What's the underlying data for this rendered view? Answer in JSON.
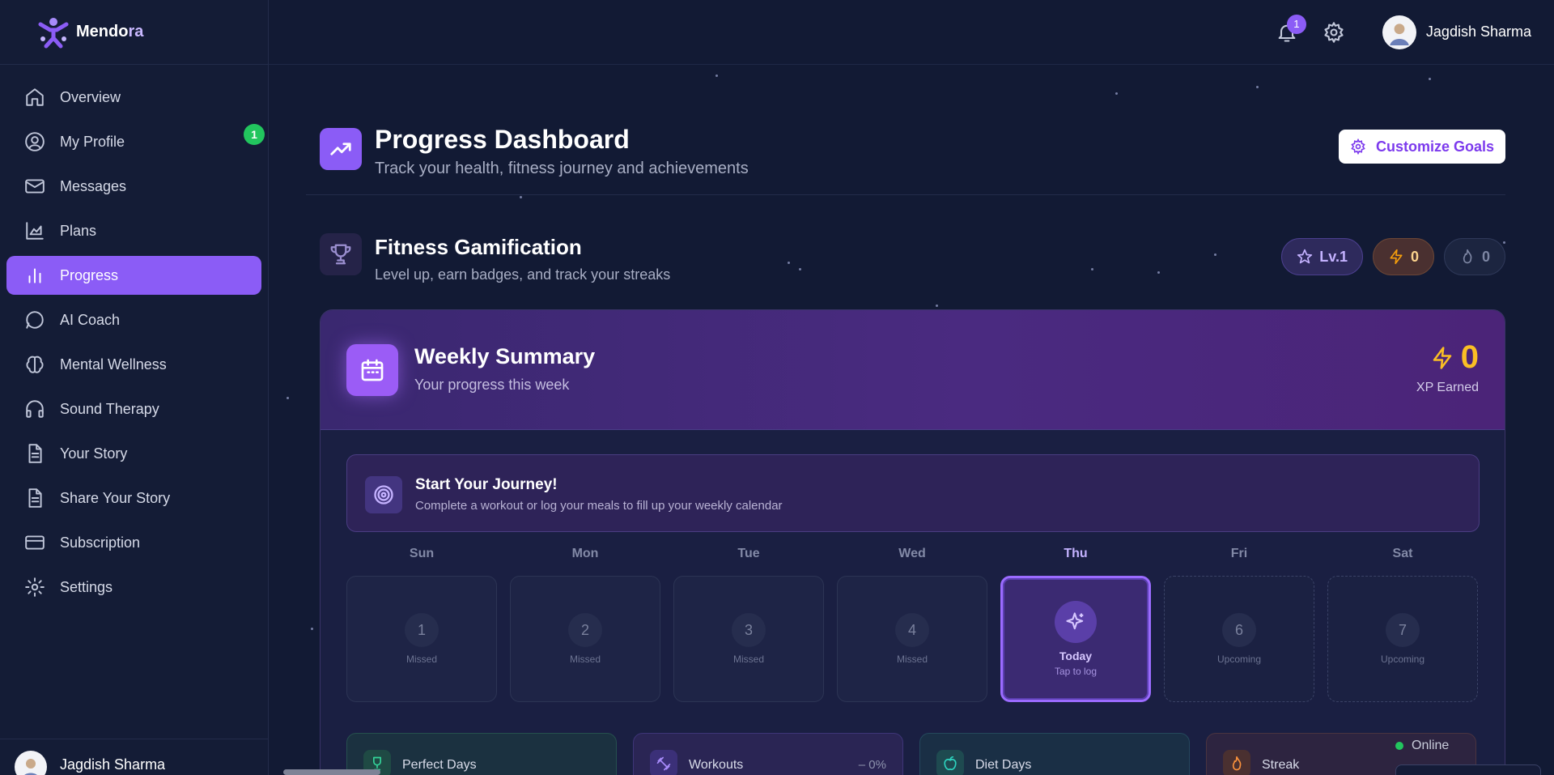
{
  "brand": {
    "name_main": "Mendo",
    "name_accent": "ra"
  },
  "sidebar": {
    "items": [
      {
        "label": "Overview",
        "icon": "home-icon"
      },
      {
        "label": "My Profile",
        "icon": "user-circle-icon",
        "badge": "1"
      },
      {
        "label": "Messages",
        "icon": "mail-icon"
      },
      {
        "label": "Plans",
        "icon": "chart-area-icon"
      },
      {
        "label": "Progress",
        "icon": "bar-chart-icon",
        "active": true
      },
      {
        "label": "AI Coach",
        "icon": "chat-bubble-icon"
      },
      {
        "label": "Mental Wellness",
        "icon": "brain-icon"
      },
      {
        "label": "Sound Therapy",
        "icon": "headphones-icon"
      },
      {
        "label": "Your Story",
        "icon": "document-icon"
      },
      {
        "label": "Share Your Story",
        "icon": "document-icon"
      },
      {
        "label": "Subscription",
        "icon": "credit-card-icon"
      },
      {
        "label": "Settings",
        "icon": "gear-icon"
      }
    ],
    "footer_user": "Jagdish Sharma"
  },
  "topbar": {
    "notification_count": "1",
    "user_name": "Jagdish Sharma"
  },
  "header": {
    "title": "Progress Dashboard",
    "subtitle": "Track your health, fitness journey and achievements",
    "customize_label": "Customize Goals"
  },
  "gamification": {
    "title": "Fitness Gamification",
    "subtitle": "Level up, earn badges, and track your streaks",
    "level": "Lv.1",
    "xp": "0",
    "streak": "0"
  },
  "weekly": {
    "title": "Weekly Summary",
    "subtitle": "Your progress this week",
    "xp_value": "0",
    "xp_label": "XP Earned",
    "journey_title": "Start Your Journey!",
    "journey_sub": "Complete a workout or log your meals to fill up your weekly calendar",
    "days": [
      {
        "name": "Sun",
        "num": "1",
        "status": "Missed"
      },
      {
        "name": "Mon",
        "num": "2",
        "status": "Missed"
      },
      {
        "name": "Tue",
        "num": "3",
        "status": "Missed"
      },
      {
        "name": "Wed",
        "num": "4",
        "status": "Missed"
      },
      {
        "name": "Thu",
        "today_label": "Today",
        "today_sub": "Tap to log"
      },
      {
        "name": "Fri",
        "num": "6",
        "status": "Upcoming"
      },
      {
        "name": "Sat",
        "num": "7",
        "status": "Upcoming"
      }
    ],
    "stats": [
      {
        "label": "Perfect Days",
        "icon": "trophy-icon"
      },
      {
        "label": "Workouts",
        "value": "– 0%",
        "icon": "dumbbell-icon"
      },
      {
        "label": "Diet Days",
        "icon": "apple-icon"
      },
      {
        "label": "Streak",
        "icon": "flame-icon"
      }
    ]
  },
  "presence": {
    "status": "Online"
  },
  "colors": {
    "accent": "#8b5cf6",
    "background": "#121a34",
    "success": "#22c55e",
    "xp": "#fbbf24"
  }
}
